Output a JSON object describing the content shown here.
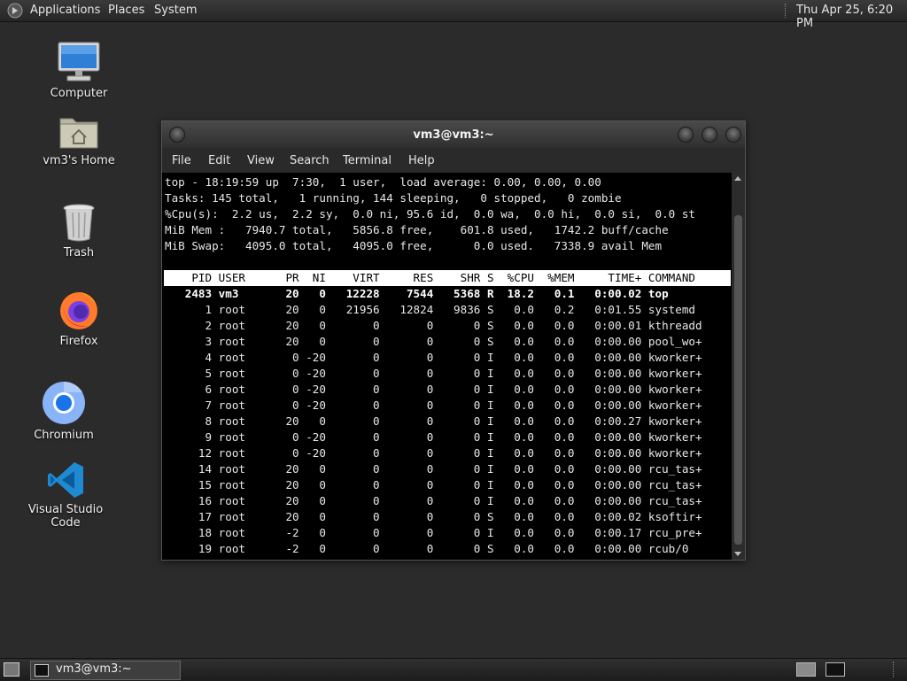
{
  "top_panel": {
    "menus": [
      "Applications",
      "Places",
      "System"
    ],
    "clock": "Thu Apr 25,  6:20 PM"
  },
  "desktop_icons": [
    {
      "label": "Computer",
      "icon": "computer-icon"
    },
    {
      "label": "vm3's Home",
      "icon": "home-folder-icon"
    },
    {
      "label": "Trash",
      "icon": "trash-icon"
    },
    {
      "label": "Firefox",
      "icon": "firefox-icon"
    },
    {
      "label": "Chromium",
      "icon": "chromium-icon"
    },
    {
      "label": "Visual Studio Code",
      "icon": "vscode-icon"
    }
  ],
  "terminal": {
    "title": "vm3@vm3:~",
    "menu": [
      "File",
      "Edit",
      "View",
      "Search",
      "Terminal",
      "Help"
    ],
    "summary": [
      "top - 18:19:59 up  7:30,  1 user,  load average: 0.00, 0.00, 0.00",
      "Tasks: 145 total,   1 running, 144 sleeping,   0 stopped,   0 zombie",
      "%Cpu(s):  2.2 us,  2.2 sy,  0.0 ni, 95.6 id,  0.0 wa,  0.0 hi,  0.0 si,  0.0 st",
      "MiB Mem :   7940.7 total,   5856.8 free,    601.8 used,   1742.2 buff/cache",
      "MiB Swap:   4095.0 total,   4095.0 free,      0.0 used.   7338.9 avail Mem"
    ],
    "columns": [
      "PID",
      "USER",
      "PR",
      "NI",
      "VIRT",
      "RES",
      "SHR",
      "S",
      "%CPU",
      "%MEM",
      "TIME+",
      "COMMAND"
    ],
    "processes": [
      {
        "pid": "2483",
        "user": "vm3",
        "pr": "20",
        "ni": "0",
        "virt": "12228",
        "res": "7544",
        "shr": "5368",
        "s": "R",
        "cpu": "18.2",
        "mem": "0.1",
        "time": "0:00.02",
        "cmd": "top"
      },
      {
        "pid": "1",
        "user": "root",
        "pr": "20",
        "ni": "0",
        "virt": "21956",
        "res": "12824",
        "shr": "9836",
        "s": "S",
        "cpu": "0.0",
        "mem": "0.2",
        "time": "0:01.55",
        "cmd": "systemd"
      },
      {
        "pid": "2",
        "user": "root",
        "pr": "20",
        "ni": "0",
        "virt": "0",
        "res": "0",
        "shr": "0",
        "s": "S",
        "cpu": "0.0",
        "mem": "0.0",
        "time": "0:00.01",
        "cmd": "kthreadd"
      },
      {
        "pid": "3",
        "user": "root",
        "pr": "20",
        "ni": "0",
        "virt": "0",
        "res": "0",
        "shr": "0",
        "s": "S",
        "cpu": "0.0",
        "mem": "0.0",
        "time": "0:00.00",
        "cmd": "pool_wo+"
      },
      {
        "pid": "4",
        "user": "root",
        "pr": "0",
        "ni": "-20",
        "virt": "0",
        "res": "0",
        "shr": "0",
        "s": "I",
        "cpu": "0.0",
        "mem": "0.0",
        "time": "0:00.00",
        "cmd": "kworker+"
      },
      {
        "pid": "5",
        "user": "root",
        "pr": "0",
        "ni": "-20",
        "virt": "0",
        "res": "0",
        "shr": "0",
        "s": "I",
        "cpu": "0.0",
        "mem": "0.0",
        "time": "0:00.00",
        "cmd": "kworker+"
      },
      {
        "pid": "6",
        "user": "root",
        "pr": "0",
        "ni": "-20",
        "virt": "0",
        "res": "0",
        "shr": "0",
        "s": "I",
        "cpu": "0.0",
        "mem": "0.0",
        "time": "0:00.00",
        "cmd": "kworker+"
      },
      {
        "pid": "7",
        "user": "root",
        "pr": "0",
        "ni": "-20",
        "virt": "0",
        "res": "0",
        "shr": "0",
        "s": "I",
        "cpu": "0.0",
        "mem": "0.0",
        "time": "0:00.00",
        "cmd": "kworker+"
      },
      {
        "pid": "8",
        "user": "root",
        "pr": "20",
        "ni": "0",
        "virt": "0",
        "res": "0",
        "shr": "0",
        "s": "I",
        "cpu": "0.0",
        "mem": "0.0",
        "time": "0:00.27",
        "cmd": "kworker+"
      },
      {
        "pid": "9",
        "user": "root",
        "pr": "0",
        "ni": "-20",
        "virt": "0",
        "res": "0",
        "shr": "0",
        "s": "I",
        "cpu": "0.0",
        "mem": "0.0",
        "time": "0:00.00",
        "cmd": "kworker+"
      },
      {
        "pid": "12",
        "user": "root",
        "pr": "0",
        "ni": "-20",
        "virt": "0",
        "res": "0",
        "shr": "0",
        "s": "I",
        "cpu": "0.0",
        "mem": "0.0",
        "time": "0:00.00",
        "cmd": "kworker+"
      },
      {
        "pid": "14",
        "user": "root",
        "pr": "20",
        "ni": "0",
        "virt": "0",
        "res": "0",
        "shr": "0",
        "s": "I",
        "cpu": "0.0",
        "mem": "0.0",
        "time": "0:00.00",
        "cmd": "rcu_tas+"
      },
      {
        "pid": "15",
        "user": "root",
        "pr": "20",
        "ni": "0",
        "virt": "0",
        "res": "0",
        "shr": "0",
        "s": "I",
        "cpu": "0.0",
        "mem": "0.0",
        "time": "0:00.00",
        "cmd": "rcu_tas+"
      },
      {
        "pid": "16",
        "user": "root",
        "pr": "20",
        "ni": "0",
        "virt": "0",
        "res": "0",
        "shr": "0",
        "s": "I",
        "cpu": "0.0",
        "mem": "0.0",
        "time": "0:00.00",
        "cmd": "rcu_tas+"
      },
      {
        "pid": "17",
        "user": "root",
        "pr": "20",
        "ni": "0",
        "virt": "0",
        "res": "0",
        "shr": "0",
        "s": "S",
        "cpu": "0.0",
        "mem": "0.0",
        "time": "0:00.02",
        "cmd": "ksoftir+"
      },
      {
        "pid": "18",
        "user": "root",
        "pr": "-2",
        "ni": "0",
        "virt": "0",
        "res": "0",
        "shr": "0",
        "s": "I",
        "cpu": "0.0",
        "mem": "0.0",
        "time": "0:00.17",
        "cmd": "rcu_pre+"
      },
      {
        "pid": "19",
        "user": "root",
        "pr": "-2",
        "ni": "0",
        "virt": "0",
        "res": "0",
        "shr": "0",
        "s": "S",
        "cpu": "0.0",
        "mem": "0.0",
        "time": "0:00.00",
        "cmd": "rcub/0"
      }
    ]
  },
  "taskbar": {
    "task_label": "vm3@vm3:~"
  },
  "colors": {
    "desktop": "#2b2b2b",
    "terminal_bg": "#000000",
    "terminal_fg": "#e8e8e8",
    "header_bg": "#ffffff"
  }
}
